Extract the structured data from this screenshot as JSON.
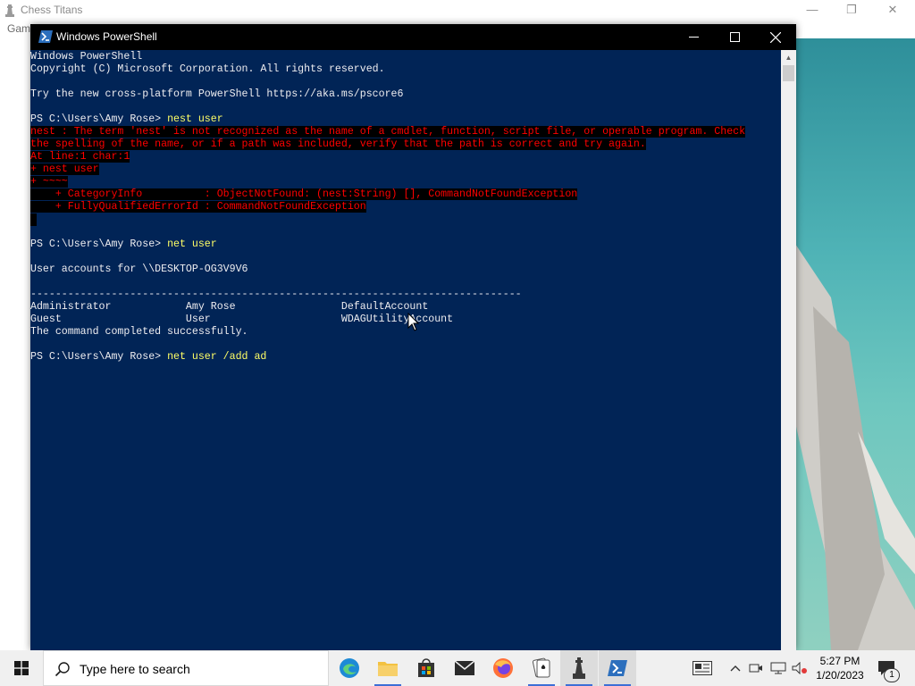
{
  "background_window": {
    "title": "Chess Titans",
    "menu_label": "Gam",
    "controls": {
      "minimize": "—",
      "maximize": "❐",
      "close": "✕"
    }
  },
  "powershell": {
    "title": "Windows PowerShell",
    "lines": {
      "l1": "Windows PowerShell",
      "l2": "Copyright (C) Microsoft Corporation. All rights reserved.",
      "l3": "Try the new cross-platform PowerShell https://aka.ms/pscore6",
      "prompt1": "PS C:\\Users\\Amy Rose> ",
      "cmd1": "nest user",
      "err1": "nest : The term 'nest' is not recognized as the name of a cmdlet, function, script file, or operable program. Check",
      "err2": "the spelling of the name, or if a path was included, verify that the path is correct and try again.",
      "err3": "At line:1 char:1",
      "err4": "+ nest user",
      "err5": "+ ~~~~",
      "err6": "    + CategoryInfo          : ObjectNotFound: (nest:String) [], CommandNotFoundException",
      "err7": "    + FullyQualifiedErrorId : CommandNotFoundException",
      "prompt2": "PS C:\\Users\\Amy Rose> ",
      "cmd2": "net user",
      "accounts_header": "User accounts for \\\\DESKTOP-OG3V9V6",
      "separator": "-------------------------------------------------------------------------------",
      "row1": "Administrator            Amy Rose                 DefaultAccount",
      "row2": "Guest                    User                     WDAGUtilityAccount",
      "completed": "The command completed successfully.",
      "prompt3": "PS C:\\Users\\Amy Rose> ",
      "cmd3": "net user /add ad"
    }
  },
  "taskbar": {
    "search_placeholder": "Type here to search",
    "apps": [
      "edge-icon",
      "file-explorer-icon",
      "store-icon",
      "mail-icon",
      "firefox-icon",
      "solitaire-icon",
      "chess-icon",
      "powershell-icon"
    ],
    "clock_time": "5:27 PM",
    "clock_date": "1/20/2023",
    "notification_count": "1"
  },
  "colors": {
    "powershell_bg": "#012456",
    "error_text": "#ff0000",
    "command_text": "#ffff66",
    "taskbar_bg": "#f0f0f0"
  }
}
